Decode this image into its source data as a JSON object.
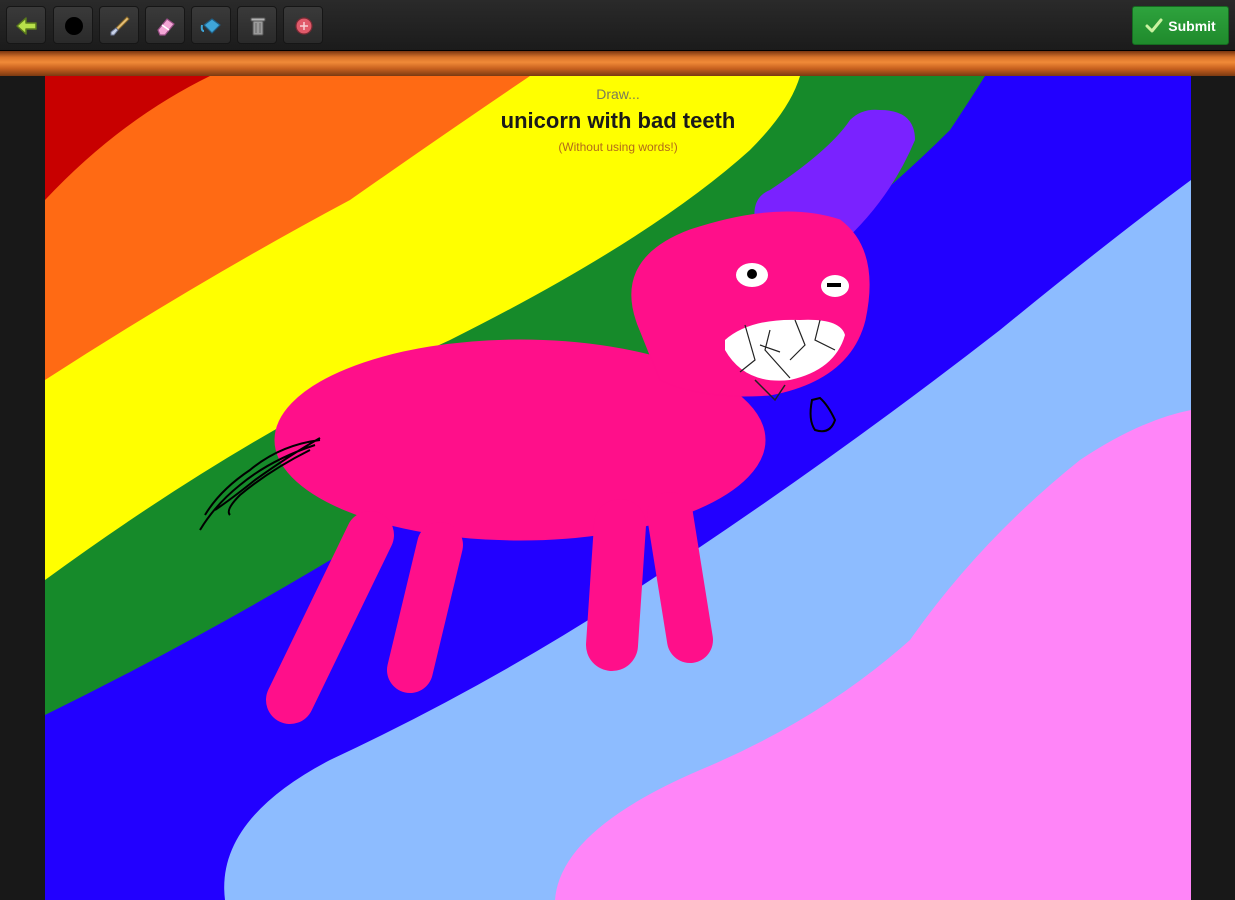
{
  "toolbar": {
    "tools": [
      {
        "id": "back",
        "icon": "arrow-left-icon"
      },
      {
        "id": "brush-size",
        "icon": "black-dot-icon"
      },
      {
        "id": "brush",
        "icon": "paintbrush-icon"
      },
      {
        "id": "eraser",
        "icon": "eraser-icon"
      },
      {
        "id": "fill",
        "icon": "paint-bucket-icon"
      },
      {
        "id": "trash",
        "icon": "trash-icon"
      },
      {
        "id": "color",
        "icon": "color-picker-icon"
      }
    ],
    "submit_label": "Submit",
    "submit_icon": "checkmark-icon",
    "submit_color": "#2a9a37"
  },
  "prompt": {
    "intro": "Draw...",
    "subject": "unicorn with bad teeth",
    "hint": "(Without using words!)"
  },
  "drawing": {
    "band_colors": [
      "#c80000",
      "#ff6a14",
      "#ffff00",
      "#168a2a",
      "#2200ff",
      "#8dbcff",
      "#ff85f8"
    ],
    "body_color": "#ff0f8a",
    "horn_color": "#7a22ff"
  }
}
